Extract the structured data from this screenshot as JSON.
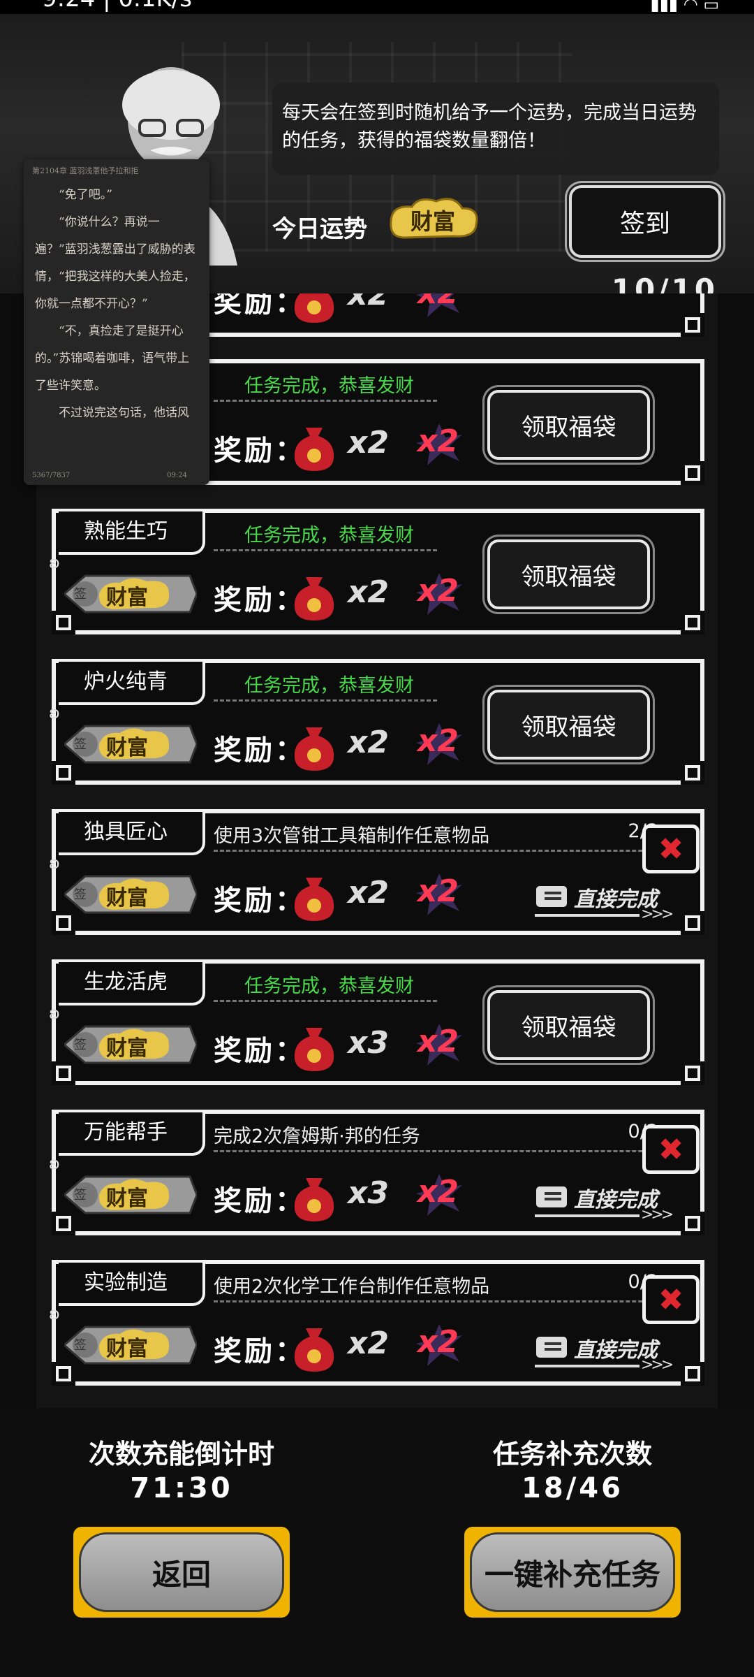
{
  "status": {
    "time": "9:24 | 0.1K/s"
  },
  "header": {
    "tip": "每天会在签到时随机给予一个运势，完成当日运势的任务，获得的福袋数量翻倍！",
    "fortune_label": "今日运势",
    "fortune_value": "财富",
    "sign_in": "签到",
    "counter": "10/10"
  },
  "overlay": {
    "header": "第2104章 蓝羽浅蔥他予拉和拒",
    "paragraphs": [
      "“免了吧。”",
      "“你说什么？再说一遍？”蓝羽浅葱露出了威胁的表情，“把我这样的大美人捡走，你就一点都不开心？”",
      "“不，真捡走了是挺开心的。”苏锦喝着咖啡，语气带上了些许笑意。",
      "不过说完这句话，他话风"
    ],
    "footer_left": "5367/7837",
    "footer_right": "09:24"
  },
  "common": {
    "reward_label": "奖励：",
    "badge_sign": "签",
    "badge_text": "财富",
    "claim": "领取福袋",
    "direct": "直接完成",
    "done_text": "任务完成，恭喜发财",
    "double": "x2",
    "cancel": "✖"
  },
  "tasks": [
    {
      "name": "",
      "status": "done",
      "desc": "",
      "progress": "",
      "multiplier": "x2"
    },
    {
      "name": "",
      "status": "done",
      "desc": "任务完成，恭喜发财",
      "progress": "",
      "multiplier": "x2"
    },
    {
      "name": "熟能生巧",
      "status": "done",
      "desc": "任务完成，恭喜发财",
      "progress": "",
      "multiplier": "x2"
    },
    {
      "name": "炉火纯青",
      "status": "done",
      "desc": "任务完成，恭喜发财",
      "progress": "",
      "multiplier": "x2"
    },
    {
      "name": "独具匠心",
      "status": "todo",
      "desc": "使用3次管钳工具箱制作任意物品",
      "progress": "2/3",
      "multiplier": "x2"
    },
    {
      "name": "生龙活虎",
      "status": "done",
      "desc": "任务完成，恭喜发财",
      "progress": "",
      "multiplier": "x3"
    },
    {
      "name": "万能帮手",
      "status": "todo",
      "desc": "完成2次詹姆斯·邦的任务",
      "progress": "0/2",
      "multiplier": "x3"
    },
    {
      "name": "实验制造",
      "status": "todo",
      "desc": "使用2次化学工作台制作任意物品",
      "progress": "0/2",
      "multiplier": "x2"
    }
  ],
  "bottom": {
    "countdown_label": "次数充能倒计时",
    "countdown_value": "71:30",
    "refill_label": "任务补充次数",
    "refill_value": "18/46",
    "back": "返回",
    "refill_button": "一键补充任务"
  },
  "colors": {
    "done_green": "#49d94a",
    "cancel_red": "#e0262e",
    "gold": "#f0b400"
  }
}
